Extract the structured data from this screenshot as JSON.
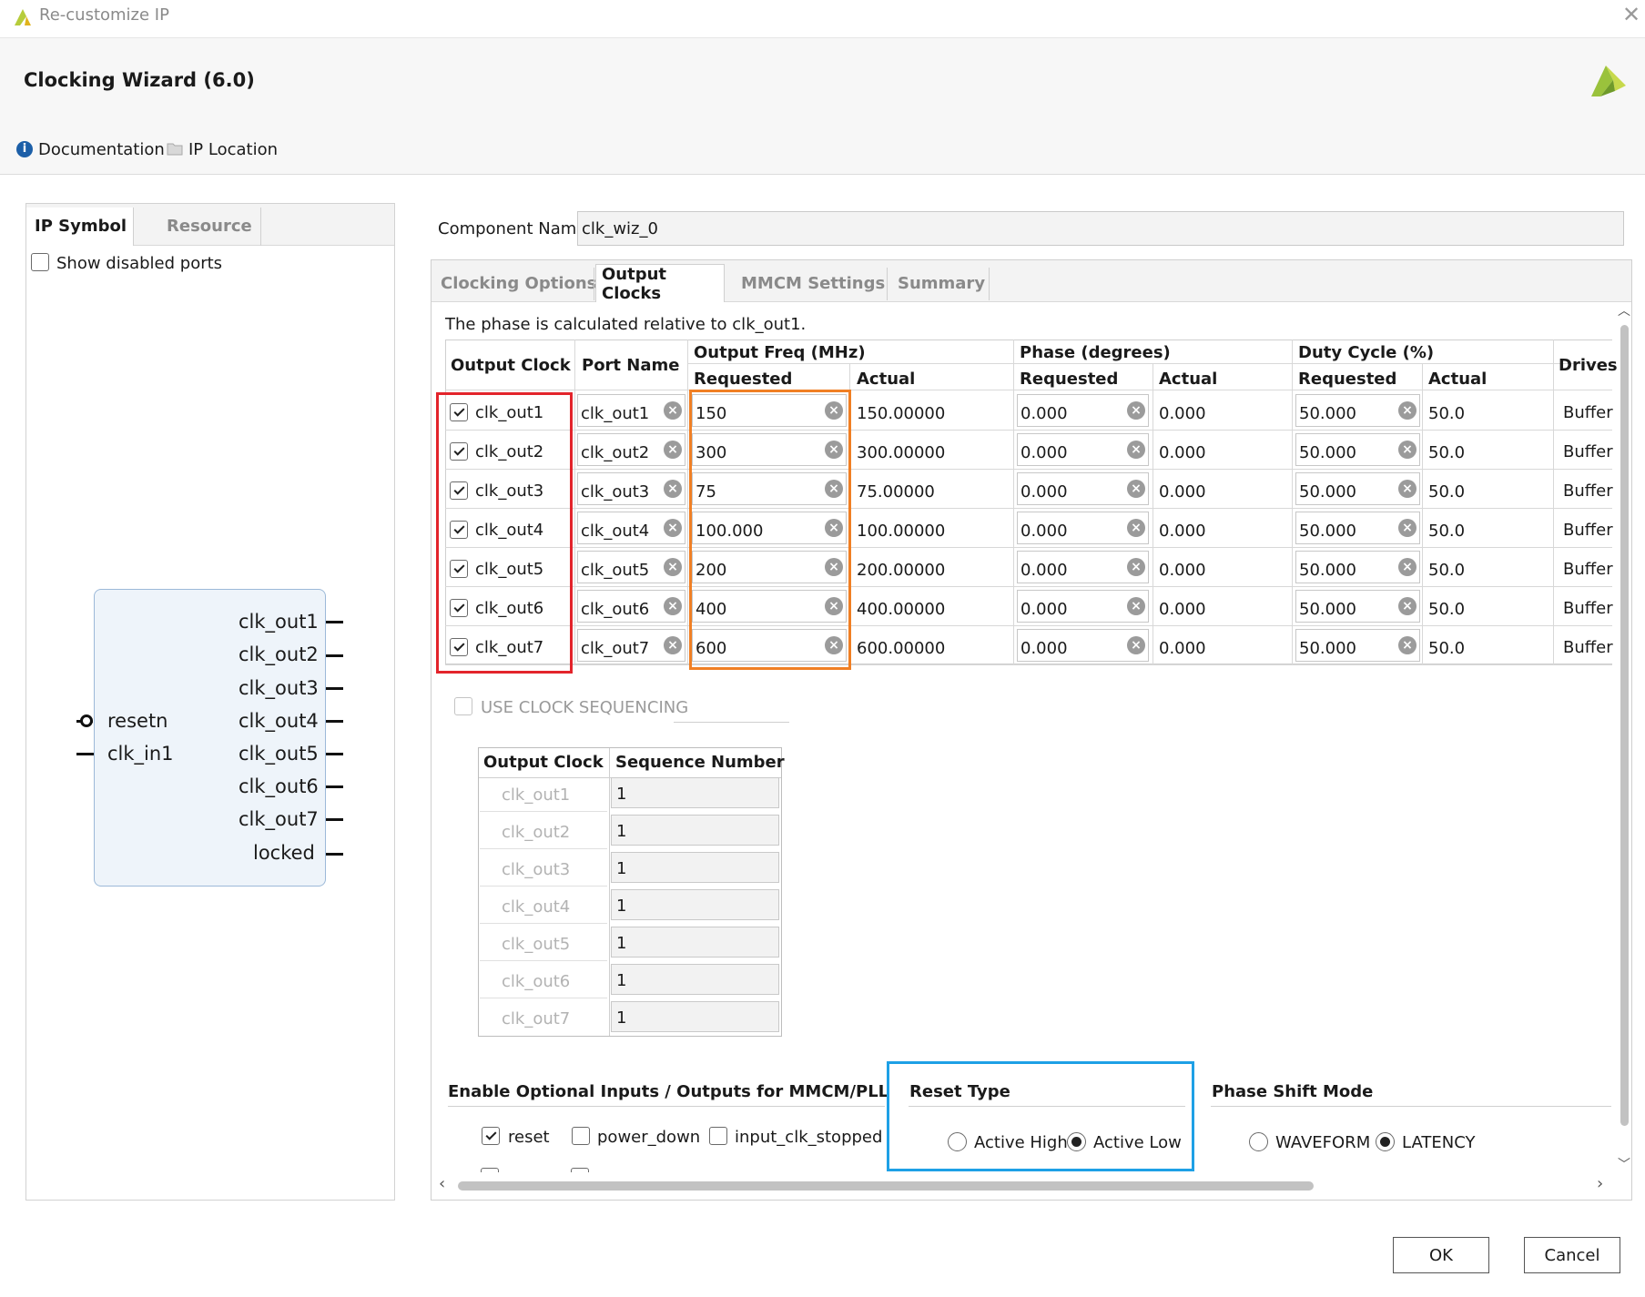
{
  "window": {
    "title": "Re-customize IP"
  },
  "header": {
    "title": "Clocking Wizard (6.0)",
    "documentation": "Documentation",
    "ip_location": "IP Location"
  },
  "left": {
    "tabs": [
      "IP Symbol",
      "Resource"
    ],
    "show_disabled_ports": "Show disabled ports",
    "symbol": {
      "inputs": [
        "resetn",
        "clk_in1"
      ],
      "outputs": [
        "clk_out1",
        "clk_out2",
        "clk_out3",
        "clk_out4",
        "clk_out5",
        "clk_out6",
        "clk_out7",
        "locked"
      ]
    }
  },
  "component": {
    "label": "Component Name",
    "value": "clk_wiz_0"
  },
  "tabs": [
    "Clocking Options",
    "Output Clocks",
    "MMCM Settings",
    "Summary"
  ],
  "output_clocks": {
    "note": "The phase is calculated relative to clk_out1.",
    "headers": {
      "output_clock": "Output Clock",
      "port_name": "Port Name",
      "output_freq": "Output Freq (MHz)",
      "phase": "Phase (degrees)",
      "duty_cycle": "Duty Cycle (%)",
      "drives": "Drives",
      "requested": "Requested",
      "actual": "Actual"
    },
    "rows": [
      {
        "clock": "clk_out1",
        "port": "clk_out1",
        "freq_req": "150",
        "freq_act": "150.00000",
        "phase_req": "0.000",
        "phase_act": "0.000",
        "duty_req": "50.000",
        "duty_act": "50.0",
        "drives": "Buffer"
      },
      {
        "clock": "clk_out2",
        "port": "clk_out2",
        "freq_req": "300",
        "freq_act": "300.00000",
        "phase_req": "0.000",
        "phase_act": "0.000",
        "duty_req": "50.000",
        "duty_act": "50.0",
        "drives": "Buffer"
      },
      {
        "clock": "clk_out3",
        "port": "clk_out3",
        "freq_req": "75",
        "freq_act": "75.00000",
        "phase_req": "0.000",
        "phase_act": "0.000",
        "duty_req": "50.000",
        "duty_act": "50.0",
        "drives": "Buffer"
      },
      {
        "clock": "clk_out4",
        "port": "clk_out4",
        "freq_req": "100.000",
        "freq_act": "100.00000",
        "phase_req": "0.000",
        "phase_act": "0.000",
        "duty_req": "50.000",
        "duty_act": "50.0",
        "drives": "Buffer"
      },
      {
        "clock": "clk_out5",
        "port": "clk_out5",
        "freq_req": "200",
        "freq_act": "200.00000",
        "phase_req": "0.000",
        "phase_act": "0.000",
        "duty_req": "50.000",
        "duty_act": "50.0",
        "drives": "Buffer"
      },
      {
        "clock": "clk_out6",
        "port": "clk_out6",
        "freq_req": "400",
        "freq_act": "400.00000",
        "phase_req": "0.000",
        "phase_act": "0.000",
        "duty_req": "50.000",
        "duty_act": "50.0",
        "drives": "Buffer"
      },
      {
        "clock": "clk_out7",
        "port": "clk_out7",
        "freq_req": "600",
        "freq_act": "600.00000",
        "phase_req": "0.000",
        "phase_act": "0.000",
        "duty_req": "50.000",
        "duty_act": "50.0",
        "drives": "Buffer"
      }
    ]
  },
  "sequencing": {
    "label": "USE CLOCK SEQUENCING",
    "headers": [
      "Output Clock",
      "Sequence Number"
    ],
    "rows": [
      {
        "clock": "clk_out1",
        "seq": "1"
      },
      {
        "clock": "clk_out2",
        "seq": "1"
      },
      {
        "clock": "clk_out3",
        "seq": "1"
      },
      {
        "clock": "clk_out4",
        "seq": "1"
      },
      {
        "clock": "clk_out5",
        "seq": "1"
      },
      {
        "clock": "clk_out6",
        "seq": "1"
      },
      {
        "clock": "clk_out7",
        "seq": "1"
      }
    ]
  },
  "optional_io": {
    "title": "Enable Optional Inputs / Outputs for MMCM/PLL",
    "items": [
      "reset",
      "power_down",
      "input_clk_stopped"
    ]
  },
  "reset_type": {
    "title": "Reset Type",
    "options": [
      "Active High",
      "Active Low"
    ],
    "selected": "Active Low"
  },
  "phase_shift": {
    "title": "Phase Shift Mode",
    "options": [
      "WAVEFORM",
      "LATENCY"
    ],
    "selected": "LATENCY"
  },
  "buttons": {
    "ok": "OK",
    "cancel": "Cancel"
  },
  "colors": {
    "highlight_red": "#e3242b",
    "highlight_orange": "#f07f24",
    "highlight_blue": "#1ea0e6",
    "logo_green": "#9ac23c"
  }
}
